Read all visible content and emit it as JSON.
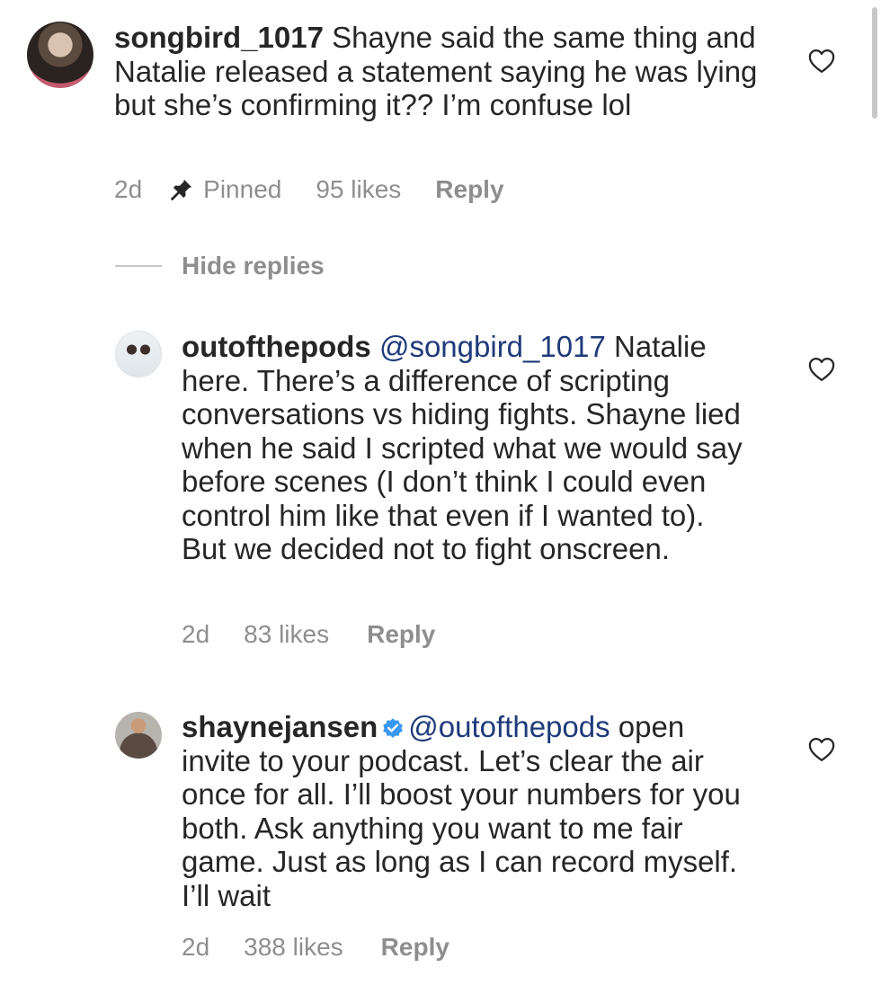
{
  "comments": [
    {
      "username": "songbird_1017",
      "body": " Shayne said the same thing and Natalie released a statement saying he was lying but she’s confirming it?? I’m confuse lol",
      "time": "2d",
      "pinned_label": "Pinned",
      "likes": "95 likes",
      "reply_label": "Reply"
    },
    {
      "username": "outofthepods",
      "mention": "@songbird_1017",
      "body": " Natalie here. There’s a difference of scripting conversations vs hiding fights. Shayne lied when he said I scripted what we would say before scenes (I don’t think I could even control him like that even if I wanted to). But we decided not to fight onscreen.",
      "time": "2d",
      "likes": "83 likes",
      "reply_label": "Reply"
    },
    {
      "username": "shaynejansen",
      "mention": "@outofthepods",
      "body": " open invite to your podcast. Let’s clear the air once  for all. I’ll boost your numbers for you both. Ask anything you want to me fair game. Just as long as I can record myself. I’ll wait",
      "time": "2d",
      "likes": "388 likes",
      "reply_label": "Reply"
    }
  ],
  "hide_replies_label": "Hide replies",
  "icons": {
    "like": "heart-icon",
    "pin": "pin-icon",
    "verified": "verified-badge-icon"
  },
  "colors": {
    "text": "#262626",
    "muted": "#8e8e8e",
    "mention": "#1f3a7a",
    "verified": "#3897f0"
  }
}
